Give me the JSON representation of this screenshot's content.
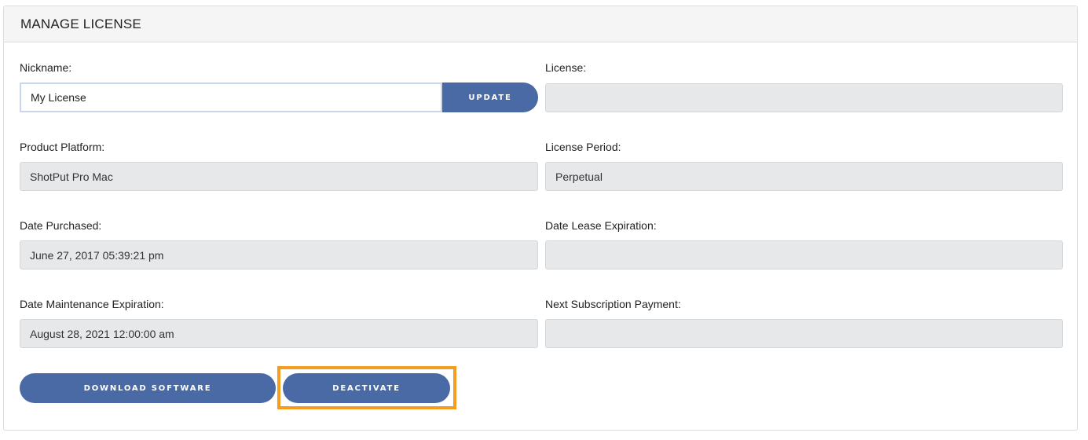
{
  "panel": {
    "title": "MANAGE LICENSE"
  },
  "fields": {
    "nickname": {
      "label": "Nickname:",
      "value": "My License"
    },
    "license": {
      "label": "License:",
      "value": ""
    },
    "product_platform": {
      "label": "Product Platform:",
      "value": "ShotPut Pro Mac"
    },
    "license_period": {
      "label": "License Period:",
      "value": "Perpetual"
    },
    "date_purchased": {
      "label": "Date Purchased:",
      "value": "June 27, 2017 05:39:21 pm"
    },
    "date_lease_expiration": {
      "label": "Date Lease Expiration:",
      "value": ""
    },
    "date_maintenance_expiration": {
      "label": "Date Maintenance Expiration:",
      "value": "August 28, 2021 12:00:00 am"
    },
    "next_subscription_payment": {
      "label": "Next Subscription Payment:",
      "value": ""
    }
  },
  "buttons": {
    "update": "UPDATE",
    "download_software": "DOWNLOAD SOFTWARE",
    "deactivate": "DEACTIVATE"
  },
  "colors": {
    "button": "#4a6aa5",
    "highlight": "#f39c1d",
    "readonly_bg": "#e6e8ea"
  }
}
